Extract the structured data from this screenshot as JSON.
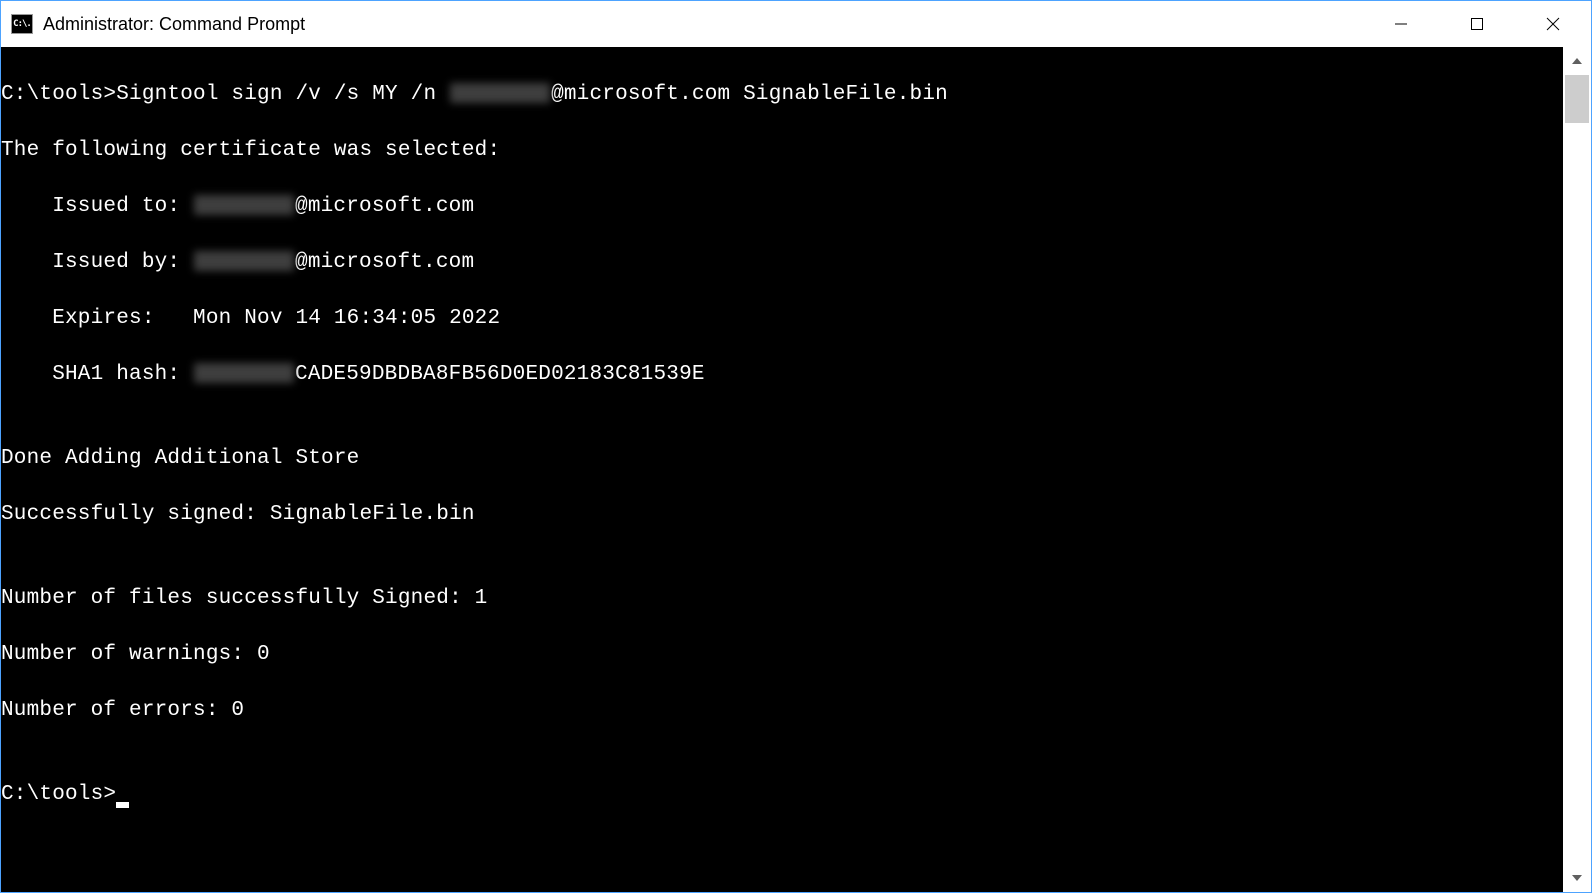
{
  "window": {
    "title": "Administrator: Command Prompt"
  },
  "console": {
    "prompt1": "C:\\tools>",
    "command": "Signtool sign /v /s MY /n ",
    "command_suffix": "@microsoft.com SignableFile.bin",
    "cert_header": "The following certificate was selected:",
    "issued_to_label": "    Issued to: ",
    "issued_to_suffix": "@microsoft.com",
    "issued_by_label": "    Issued by: ",
    "issued_by_suffix": "@microsoft.com",
    "expires": "    Expires:   Mon Nov 14 16:34:05 2022",
    "sha1_label": "    SHA1 hash: ",
    "sha1_suffix": "CADE59DBDBA8FB56D0ED02183C81539E",
    "blank1": "",
    "done_adding": "Done Adding Additional Store",
    "success_signed": "Successfully signed: SignableFile.bin",
    "blank2": "",
    "num_signed": "Number of files successfully Signed: 1",
    "num_warnings": "Number of warnings: 0",
    "num_errors": "Number of errors: 0",
    "blank3": "",
    "prompt2": "C:\\tools>"
  }
}
